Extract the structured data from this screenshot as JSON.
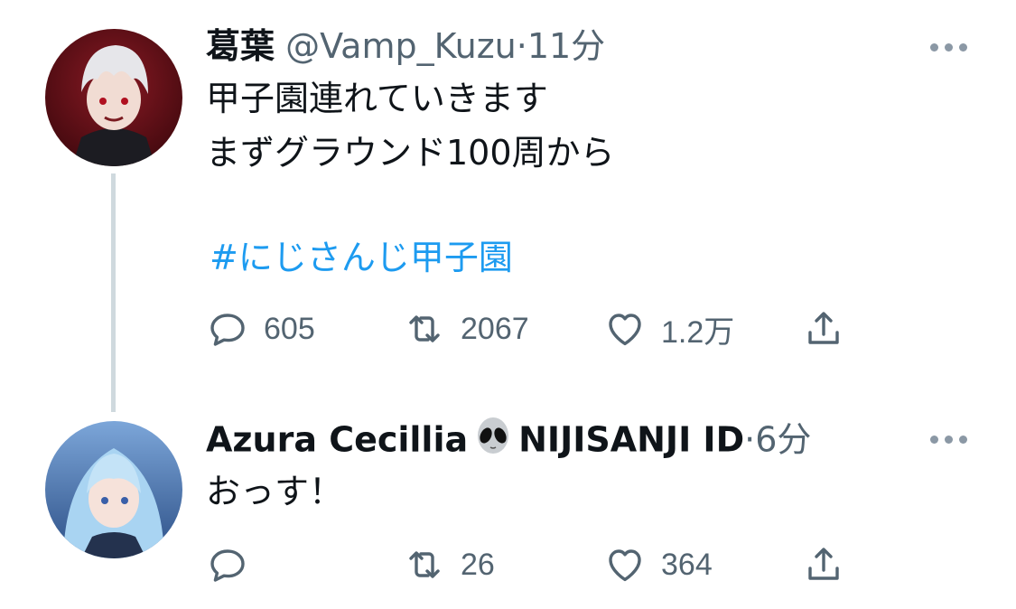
{
  "tweet1": {
    "display_name": "葛葉",
    "handle": "@Vamp_Kuzu",
    "separator": "·",
    "time": "11分",
    "text_line1": "甲子園連れていきます",
    "text_line2": "まずグラウンド100周から",
    "hashtag": "#にじさんじ甲子園",
    "replies": "605",
    "retweets": "2067",
    "likes": "1.2万"
  },
  "tweet2": {
    "display_name_part1": "Azura Cecillia",
    "display_name_part2": "NIJISANJI ID",
    "separator": "·",
    "time": "6分",
    "text": "おっす！",
    "replies": "",
    "retweets": "26",
    "likes": "364"
  },
  "icons": [
    "reply-icon",
    "retweet-icon",
    "like-icon",
    "share-icon",
    "more-icon",
    "alien-emoji"
  ],
  "colors": {
    "text": "#0f1419",
    "secondary": "#536471",
    "link": "#1d9bf0",
    "thread": "#cfd9de"
  }
}
